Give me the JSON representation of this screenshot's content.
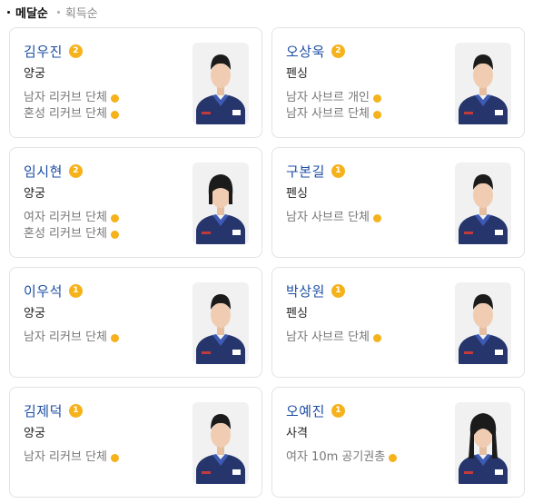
{
  "sort": {
    "options": [
      {
        "label": "메달순",
        "active": true
      },
      {
        "label": "획득순",
        "active": false
      }
    ]
  },
  "athletes": [
    {
      "name": "김우진",
      "medal_count": "2",
      "sport": "양궁",
      "events": [
        "남자 리커브 단체",
        "혼성 리커브 단체"
      ],
      "hair": "short",
      "medal_color": "#f5b21b"
    },
    {
      "name": "오상욱",
      "medal_count": "2",
      "sport": "펜싱",
      "events": [
        "남자 사브르 개인",
        "남자 사브르 단체"
      ],
      "hair": "short",
      "medal_color": "#f5b21b"
    },
    {
      "name": "임시현",
      "medal_count": "2",
      "sport": "양궁",
      "events": [
        "여자 리커브 단체",
        "혼성 리커브 단체"
      ],
      "hair": "bob",
      "medal_color": "#f5b21b"
    },
    {
      "name": "구본길",
      "medal_count": "1",
      "sport": "펜싱",
      "events": [
        "남자 사브르 단체"
      ],
      "hair": "short",
      "medal_color": "#f5b21b"
    },
    {
      "name": "이우석",
      "medal_count": "1",
      "sport": "양궁",
      "events": [
        "남자 리커브 단체"
      ],
      "hair": "short",
      "medal_color": "#f5b21b"
    },
    {
      "name": "박상원",
      "medal_count": "1",
      "sport": "펜싱",
      "events": [
        "남자 사브르 단체"
      ],
      "hair": "short",
      "medal_color": "#f5b21b"
    },
    {
      "name": "김제덕",
      "medal_count": "1",
      "sport": "양궁",
      "events": [
        "남자 리커브 단체"
      ],
      "hair": "short",
      "medal_color": "#f5b21b"
    },
    {
      "name": "오예진",
      "medal_count": "1",
      "sport": "사격",
      "events": [
        "여자 10m 공기권총"
      ],
      "hair": "long",
      "medal_color": "#f5b21b"
    }
  ]
}
